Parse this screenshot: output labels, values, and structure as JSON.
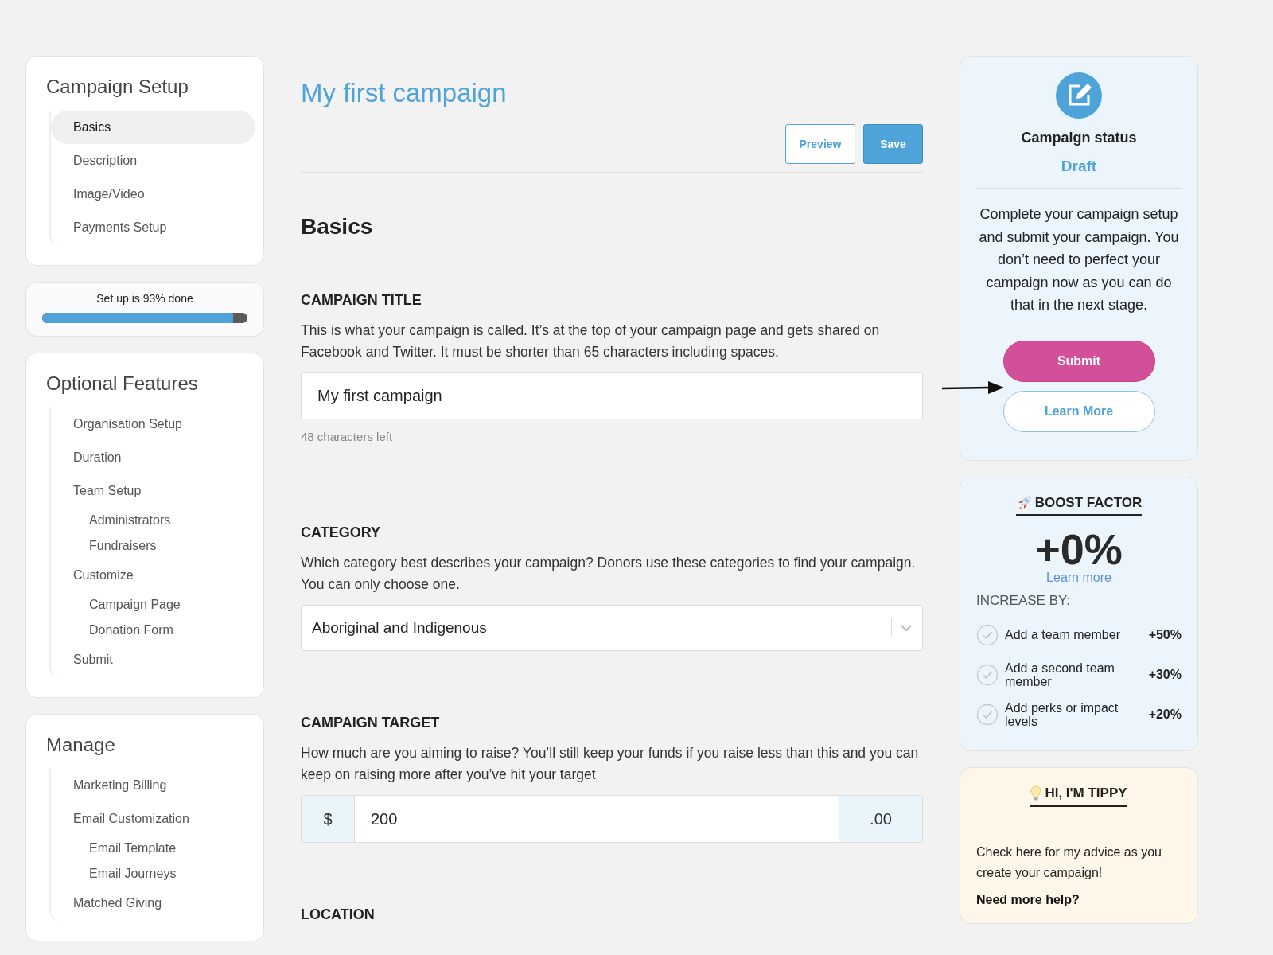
{
  "sidebar": {
    "setup": {
      "title": "Campaign Setup",
      "items": [
        {
          "label": "Basics",
          "selected": true
        },
        {
          "label": "Description",
          "selected": false
        },
        {
          "label": "Image/Video",
          "selected": false
        },
        {
          "label": "Payments Setup",
          "selected": false
        }
      ]
    },
    "progress": {
      "label": "Set up is 93% done",
      "level": 0.93
    },
    "optional": {
      "title": "Optional Features",
      "items": [
        {
          "label": "Organisation Setup",
          "selected": false
        },
        {
          "label": "Duration",
          "selected": false
        },
        {
          "label": "Team Setup",
          "selected": false,
          "children": [
            {
              "label": "Administrators",
              "selected": false
            },
            {
              "label": "Fundraisers",
              "selected": false
            }
          ]
        },
        {
          "label": "Customize",
          "selected": false,
          "children": [
            {
              "label": "Campaign Page",
              "selected": false
            },
            {
              "label": "Donation Form",
              "selected": false
            }
          ]
        },
        {
          "label": "Submit",
          "selected": false
        }
      ]
    },
    "manage": {
      "title": "Manage",
      "items": [
        {
          "label": "Marketing Billing",
          "selected": false
        },
        {
          "label": "Email Customization",
          "selected": false,
          "children": [
            {
              "label": "Email Template",
              "selected": false
            },
            {
              "label": "Email Journeys",
              "selected": false
            }
          ]
        },
        {
          "label": "Matched Giving",
          "selected": false
        }
      ]
    }
  },
  "main": {
    "title": "My first campaign",
    "buttons": [
      {
        "label": "Preview",
        "kind": "outline"
      },
      {
        "label": "Save",
        "kind": "primary"
      }
    ],
    "section_title": "Basics",
    "fields": [
      {
        "kind": "text",
        "label": "CAMPAIGN TITLE",
        "help": "This is what your campaign is called. It’s at the top of your campaign page and gets shared on Facebook and Twitter. It must be shorter than 65 characters including spaces.",
        "value": "My first campaign",
        "note": "48 characters left"
      },
      {
        "kind": "select",
        "label": "CATEGORY",
        "help": "Which category best describes your campaign? Donors use these categories to find your campaign. You can only choose one.",
        "value": "Aboriginal and Indigenous"
      },
      {
        "kind": "money",
        "label": "CAMPAIGN TARGET",
        "help": "How much are you aiming to raise? You’ll still keep your funds if you raise less than this and you can keep on raising more after you’ve hit your target",
        "prefix": "$",
        "value": "200",
        "suffix": ".00"
      },
      {
        "kind": "heading",
        "label": "LOCATION"
      }
    ]
  },
  "status": {
    "title": "Campaign status",
    "state": "Draft",
    "text": "Complete your campaign setup and submit your campaign. You don’t need to perfect your campaign now as you can do that in the next stage.",
    "buttons": [
      {
        "label": "Submit",
        "kind": "primary"
      },
      {
        "label": "Learn More",
        "kind": "outline"
      }
    ]
  },
  "boost": {
    "title": "BOOST FACTOR",
    "value": "+0%",
    "link": "Learn more",
    "increase_label": "INCREASE BY:",
    "items": [
      {
        "label": "Add a team member",
        "amount": "+50%",
        "checked": false
      },
      {
        "label": "Add a second team member",
        "amount": "+30%",
        "checked": false
      },
      {
        "label": "Add perks or impact levels",
        "amount": "+20%",
        "checked": false
      }
    ]
  },
  "tippy": {
    "title": "HI, I'M TIPPY",
    "text": "Check here for my advice as you create your campaign!",
    "help_heading": "Need more help?"
  }
}
